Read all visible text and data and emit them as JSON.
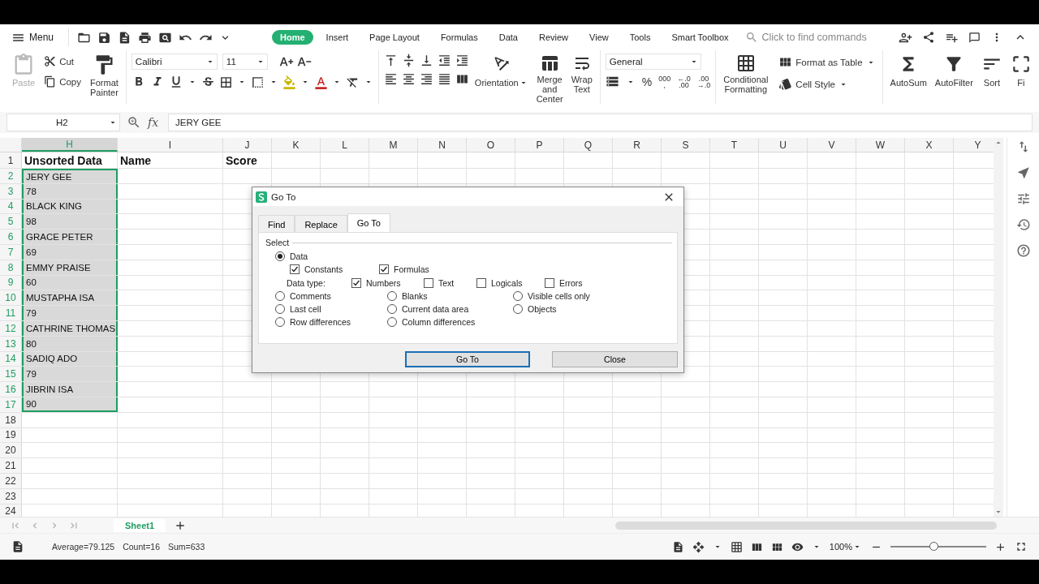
{
  "menu_bar": {
    "menu": "Menu",
    "tabs": [
      {
        "label": "Home",
        "selected": true
      },
      {
        "label": "Insert",
        "selected": false
      },
      {
        "label": "Page Layout",
        "selected": false
      },
      {
        "label": "Formulas",
        "selected": false
      },
      {
        "label": "Data",
        "selected": false
      },
      {
        "label": "Review",
        "selected": false
      },
      {
        "label": "View",
        "selected": false
      },
      {
        "label": "Tools",
        "selected": false
      },
      {
        "label": "Smart Toolbox",
        "selected": false
      }
    ],
    "search": {
      "placeholder": "Click to find commands"
    }
  },
  "ribbon": {
    "clipboard": [
      {
        "label": "Paste",
        "kind": "large",
        "disabled": true
      },
      {
        "label": "Cut",
        "kind": "small",
        "disabled": false
      },
      {
        "label": "Copy",
        "kind": "small",
        "disabled": false
      },
      {
        "label": "Format Painter",
        "kind": "large",
        "disabled": false
      }
    ],
    "font": {
      "name": "Calibri",
      "size": "11"
    },
    "alignment": {
      "orientation": "Orientation",
      "merge": "Merge and Center",
      "wrap": "Wrap Text"
    },
    "number": {
      "format": "General",
      "percent": "%",
      "tools": [
        {
          "lines": [
            "000",
            ","
          ]
        },
        {
          "lines": [
            "←.0",
            ".00"
          ]
        },
        {
          "lines": [
            ".00",
            "→.0"
          ]
        }
      ]
    },
    "styles": {
      "conditional": "Conditional Formatting",
      "table": "Format as Table",
      "cell_style": "Cell Style"
    },
    "editing": [
      "AutoSum",
      "AutoFilter",
      "Sort",
      "Fi"
    ]
  },
  "formula_bar": {
    "name_box": "H2",
    "function_label": "fx",
    "value": "JERY GEE"
  },
  "sheet": {
    "columns": [
      {
        "label": "H",
        "selected": true
      },
      {
        "label": "I",
        "selected": false
      },
      {
        "label": "J",
        "selected": false
      },
      {
        "label": "K",
        "selected": false
      },
      {
        "label": "L",
        "selected": false
      },
      {
        "label": "M",
        "selected": false
      },
      {
        "label": "N",
        "selected": false
      },
      {
        "label": "O",
        "selected": false
      },
      {
        "label": "P",
        "selected": false
      },
      {
        "label": "Q",
        "selected": false
      },
      {
        "label": "R",
        "selected": false
      },
      {
        "label": "S",
        "selected": false
      },
      {
        "label": "T",
        "selected": false
      },
      {
        "label": "U",
        "selected": false
      },
      {
        "label": "V",
        "selected": false
      },
      {
        "label": "W",
        "selected": false
      },
      {
        "label": "X",
        "selected": false
      },
      {
        "label": "Y",
        "selected": false
      }
    ],
    "rows": [
      {
        "number": "1",
        "selected": false,
        "bold": true,
        "cells": [
          "Unsorted Data",
          "Name",
          "Score"
        ]
      },
      {
        "number": "2",
        "selected": true,
        "bold": false,
        "cells": [
          "JERY GEE"
        ]
      },
      {
        "number": "3",
        "selected": true,
        "bold": false,
        "cells": [
          "78"
        ]
      },
      {
        "number": "4",
        "selected": true,
        "bold": false,
        "cells": [
          "BLACK KING"
        ]
      },
      {
        "number": "5",
        "selected": true,
        "bold": false,
        "cells": [
          "98"
        ]
      },
      {
        "number": "6",
        "selected": true,
        "bold": false,
        "cells": [
          "GRACE PETER"
        ]
      },
      {
        "number": "7",
        "selected": true,
        "bold": false,
        "cells": [
          "69"
        ]
      },
      {
        "number": "8",
        "selected": true,
        "bold": false,
        "cells": [
          "EMMY PRAISE"
        ]
      },
      {
        "number": "9",
        "selected": true,
        "bold": false,
        "cells": [
          "60"
        ]
      },
      {
        "number": "10",
        "selected": true,
        "bold": false,
        "cells": [
          "MUSTAPHA ISA"
        ]
      },
      {
        "number": "11",
        "selected": true,
        "bold": false,
        "cells": [
          "79"
        ]
      },
      {
        "number": "12",
        "selected": true,
        "bold": false,
        "cells": [
          "CATHRINE THOMAS"
        ]
      },
      {
        "number": "13",
        "selected": true,
        "bold": false,
        "cells": [
          "80"
        ]
      },
      {
        "number": "14",
        "selected": true,
        "bold": false,
        "cells": [
          "SADIQ ADO"
        ]
      },
      {
        "number": "15",
        "selected": true,
        "bold": false,
        "cells": [
          "79"
        ]
      },
      {
        "number": "16",
        "selected": true,
        "bold": false,
        "cells": [
          "JIBRIN ISA"
        ]
      },
      {
        "number": "17",
        "selected": true,
        "bold": false,
        "cells": [
          "90"
        ]
      },
      {
        "number": "18",
        "selected": false
      },
      {
        "number": "19",
        "selected": false
      },
      {
        "number": "20",
        "selected": false
      },
      {
        "number": "21",
        "selected": false
      },
      {
        "number": "22",
        "selected": false
      },
      {
        "number": "23",
        "selected": false
      },
      {
        "number": "24",
        "selected": false
      }
    ]
  },
  "sheet_tabs": [
    {
      "label": "Sheet1",
      "selected": true
    }
  ],
  "status_bar": {
    "stats": [
      "Average=79.125",
      "Count=16",
      "Sum=633"
    ],
    "zoom": "100%",
    "zoom_slider": {
      "level": 0.45
    }
  },
  "go_to_dialog": {
    "title": "Go To",
    "tabs": [
      {
        "label": "Find",
        "selected": false
      },
      {
        "label": "Replace",
        "selected": false
      },
      {
        "label": "Go To",
        "selected": true
      }
    ],
    "group": "Select",
    "data_option": {
      "label": "Data",
      "selected": true
    },
    "data_sources": [
      {
        "label": "Constants",
        "checked": true
      },
      {
        "label": "Formulas",
        "checked": true
      }
    ],
    "data_type": {
      "label": "Data type:",
      "types": [
        {
          "label": "Numbers",
          "checked": true
        },
        {
          "label": "Text",
          "checked": false
        },
        {
          "label": "Logicals",
          "checked": false
        },
        {
          "label": "Errors",
          "checked": false
        }
      ]
    },
    "other_options": [
      {
        "label": "Comments",
        "selected": false
      },
      {
        "label": "Blanks",
        "selected": false
      },
      {
        "label": "Visible cells only",
        "selected": false
      },
      {
        "label": "Last cell",
        "selected": false
      },
      {
        "label": "Current data area",
        "selected": false
      },
      {
        "label": "Objects",
        "selected": false
      },
      {
        "label": "Row differences",
        "selected": false
      },
      {
        "label": "Column differences",
        "selected": false
      }
    ],
    "buttons": [
      {
        "label": "Go To",
        "default": true
      },
      {
        "label": "Close",
        "default": false
      }
    ]
  }
}
